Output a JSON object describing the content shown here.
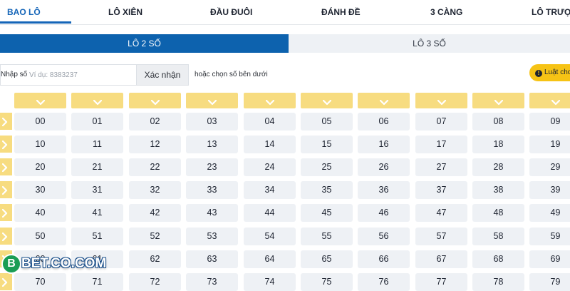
{
  "top_tabs": [
    "BAO LÔ",
    "LÔ XIÊN",
    "ĐẦU ĐUÔI",
    "ĐÁNH ĐỀ",
    "3 CÀNG",
    "LÔ TRƯỢT"
  ],
  "sub_tabs": [
    "LÔ 2 SỐ",
    "LÔ 3 SỐ"
  ],
  "input": {
    "label": "Nhập số",
    "placeholder": "Ví dụ: 8383237",
    "value": ""
  },
  "confirm_label": "Xác nhận",
  "hint": {
    "prefix": "hoặc",
    "emphasis": "chọn số bên dưới"
  },
  "rules_label": "Luật chơi",
  "grid": {
    "rows": [
      [
        "00",
        "01",
        "02",
        "03",
        "04",
        "05",
        "06",
        "07",
        "08",
        "09"
      ],
      [
        "10",
        "11",
        "12",
        "13",
        "14",
        "15",
        "16",
        "17",
        "18",
        "19"
      ],
      [
        "20",
        "21",
        "22",
        "23",
        "24",
        "25",
        "26",
        "27",
        "28",
        "29"
      ],
      [
        "30",
        "31",
        "32",
        "33",
        "34",
        "35",
        "36",
        "37",
        "38",
        "39"
      ],
      [
        "40",
        "41",
        "42",
        "43",
        "44",
        "45",
        "46",
        "47",
        "48",
        "49"
      ],
      [
        "50",
        "51",
        "52",
        "53",
        "54",
        "55",
        "56",
        "57",
        "58",
        "59"
      ],
      [
        "60",
        "61",
        "62",
        "63",
        "64",
        "65",
        "66",
        "67",
        "68",
        "69"
      ],
      [
        "70",
        "71",
        "72",
        "73",
        "74",
        "75",
        "76",
        "77",
        "78",
        "79"
      ]
    ]
  },
  "watermark": {
    "badge": "B",
    "text": "BET.CO.COM"
  },
  "colors": {
    "accent": "#0d62ae",
    "selector_yellow": "#f7dc80",
    "cell_bg": "#eef1f5",
    "rules_yellow": "#f6c315"
  },
  "icons": {
    "column_select": "chevron-down-icon",
    "row_select": "chevron-right-icon",
    "rules": "info-icon"
  }
}
